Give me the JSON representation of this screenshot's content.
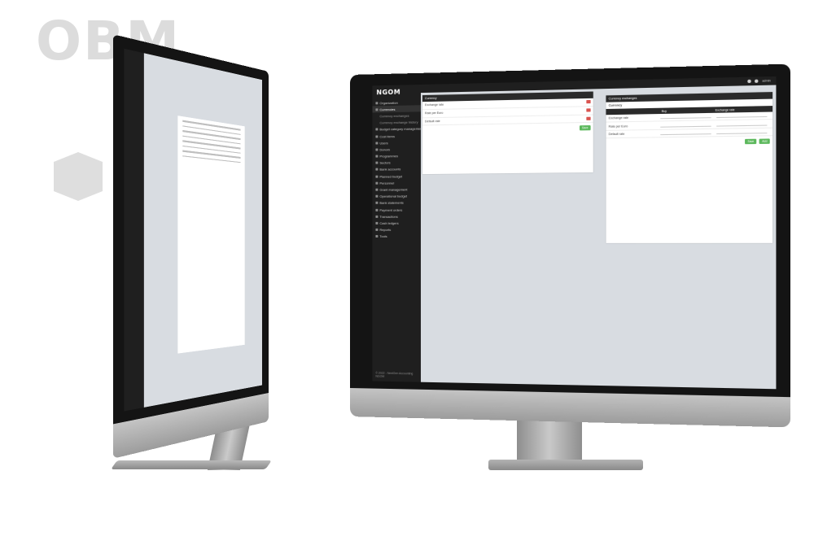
{
  "logo": {
    "text": "OBM"
  },
  "colors": {
    "sidebar": "#1f1f1f",
    "content_bg": "#d8dce1",
    "header": "#2a2a2a",
    "delete": "#d9534f",
    "save": "#5cb85c",
    "hexagon": "#dedede"
  },
  "app": {
    "brand": "NGOM",
    "sidebar": {
      "items": [
        {
          "label": "Organization",
          "icon": "building-icon"
        },
        {
          "label": "Currencies",
          "icon": "coin-icon",
          "active": true
        },
        {
          "label": "Currency exchanges",
          "sub": true
        },
        {
          "label": "Currency exchange history",
          "sub": true
        },
        {
          "label": "Budget category management",
          "icon": "folder-icon"
        },
        {
          "label": "Cost items",
          "icon": "list-icon"
        },
        {
          "label": "Users",
          "icon": "user-icon"
        },
        {
          "label": "Donors",
          "icon": "donor-icon"
        },
        {
          "label": "Programmes",
          "icon": "programme-icon"
        },
        {
          "label": "Sectors",
          "icon": "sector-icon"
        },
        {
          "label": "Bank accounts",
          "icon": "bank-icon"
        },
        {
          "label": "Planned budget",
          "icon": "budget-icon"
        },
        {
          "label": "Personnel",
          "icon": "person-icon"
        },
        {
          "label": "Grant management",
          "icon": "grant-icon"
        },
        {
          "label": "Operational budget",
          "icon": "chart-icon"
        },
        {
          "label": "Bank statements",
          "icon": "statement-icon"
        },
        {
          "label": "Payment orders",
          "icon": "payment-icon"
        },
        {
          "label": "Transactions",
          "icon": "transaction-icon"
        },
        {
          "label": "Cash ledgers",
          "icon": "cash-icon"
        },
        {
          "label": "Reports",
          "icon": "report-icon"
        },
        {
          "label": "Tools",
          "icon": "tools-icon"
        }
      ],
      "footer": "© 2022 - NextGen Accounting NGOM"
    },
    "topbar": {
      "user": "admin"
    },
    "left_panel": {
      "header": "Currency",
      "rows": [
        {
          "label": "Exchange rate"
        },
        {
          "label": "Rate per Euro"
        },
        {
          "label": "Default rate"
        }
      ]
    },
    "right_panel": {
      "header": "Currency exchanges",
      "sections": [
        {
          "title": "Currency",
          "columns": [
            "",
            "Buy",
            "Exchange rate"
          ],
          "rows": [
            "Exchange rate",
            "Rate per Euro",
            "Default rate"
          ],
          "buttons": [
            "Save",
            "Add"
          ]
        }
      ]
    }
  }
}
